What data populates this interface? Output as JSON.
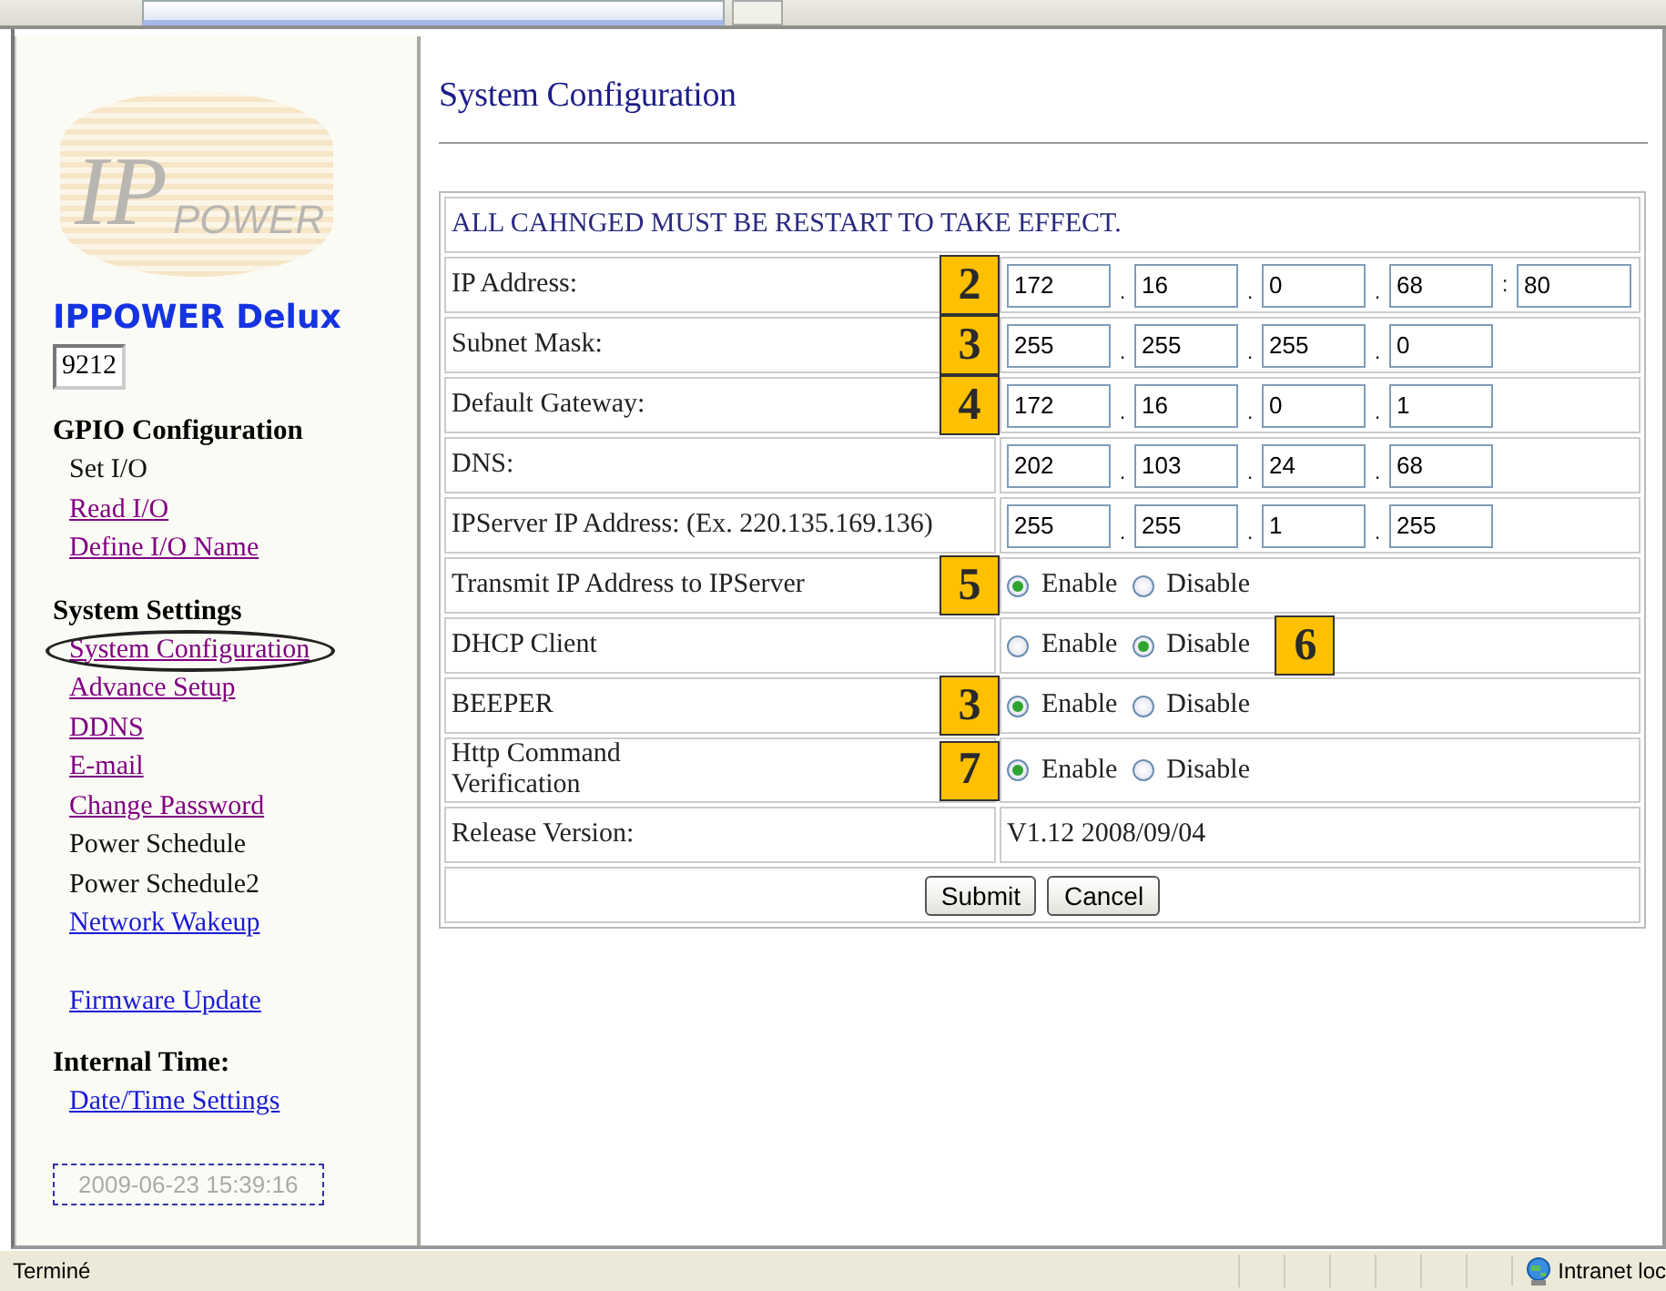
{
  "sidebar": {
    "logo": {
      "text": "IP",
      "subtext": "POWER"
    },
    "product": "IPPOWER Delux",
    "device_id": "9212",
    "sections": [
      {
        "title": "GPIO Configuration",
        "items": [
          {
            "label": "Set I/O",
            "kind": "text",
            "circled": false
          },
          {
            "label": "Read I/O",
            "kind": "visited",
            "circled": false
          },
          {
            "label": "Define I/O Name",
            "kind": "visited",
            "circled": false
          }
        ]
      },
      {
        "title": "System Settings",
        "items": [
          {
            "label": "System Configuration",
            "kind": "visited",
            "circled": true
          },
          {
            "label": "Advance Setup",
            "kind": "visited",
            "circled": false
          },
          {
            "label": "DDNS",
            "kind": "visited",
            "circled": false
          },
          {
            "label": "E-mail",
            "kind": "visited",
            "circled": false
          },
          {
            "label": "Change Password",
            "kind": "visited",
            "circled": false
          },
          {
            "label": "Power Schedule",
            "kind": "text",
            "circled": false
          },
          {
            "label": "Power Schedule2",
            "kind": "text",
            "circled": false
          },
          {
            "label": "Network Wakeup",
            "kind": "link",
            "circled": false
          }
        ]
      },
      {
        "items": [
          {
            "label": "Firmware Update",
            "kind": "link",
            "circled": false
          }
        ]
      },
      {
        "title": "Internal Time:",
        "items": [
          {
            "label": "Date/Time Settings",
            "kind": "link",
            "circled": false
          }
        ]
      }
    ],
    "clock": "2009-06-23 15:39:16"
  },
  "main": {
    "title": "System Configuration",
    "notice": "ALL CAHNGED MUST BE RESTART TO TAKE EFFECT.",
    "rows": [
      {
        "kind": "ip",
        "label": "IP Address:",
        "badge": "2",
        "octets": [
          "172",
          "16",
          "0",
          "68"
        ],
        "separators": [
          ".",
          ".",
          "."
        ],
        "port_separator": ":",
        "port": "80"
      },
      {
        "kind": "ip",
        "label": "Subnet Mask:",
        "badge": "3",
        "octets": [
          "255",
          "255",
          "255",
          "0"
        ],
        "separators": [
          ".",
          ".",
          "."
        ]
      },
      {
        "kind": "ip",
        "label": "Default Gateway:",
        "badge": "4",
        "octets": [
          "172",
          "16",
          "0",
          "1"
        ],
        "separators": [
          ".",
          ".",
          "."
        ]
      },
      {
        "kind": "ip",
        "label": "DNS:",
        "octets": [
          "202",
          "103",
          "24",
          "68"
        ],
        "separators": [
          ".",
          ".",
          "."
        ]
      },
      {
        "kind": "ip",
        "label": "IPServer IP Address: (Ex. 220.135.169.136)",
        "octets": [
          "255",
          "255",
          "1",
          "255"
        ],
        "separators": [
          ".",
          ".",
          "."
        ]
      },
      {
        "kind": "radio",
        "label": "Transmit IP Address to IPServer",
        "badge": "5",
        "options": [
          {
            "label": "Enable",
            "selected": true
          },
          {
            "label": "Disable",
            "selected": false
          }
        ]
      },
      {
        "kind": "radio",
        "label": "DHCP Client",
        "option_badge": "6",
        "options": [
          {
            "label": "Enable",
            "selected": false
          },
          {
            "label": "Disable",
            "selected": true
          }
        ]
      },
      {
        "kind": "radio",
        "label": "BEEPER",
        "badge": "3",
        "options": [
          {
            "label": "Enable",
            "selected": true
          },
          {
            "label": "Disable",
            "selected": false
          }
        ]
      },
      {
        "kind": "radio",
        "label": "Http Command\nVerification",
        "badge": "7",
        "options": [
          {
            "label": "Enable",
            "selected": true
          },
          {
            "label": "Disable",
            "selected": false
          }
        ]
      },
      {
        "kind": "text",
        "label": "Release Version:",
        "value": "V1.12 2008/09/04"
      }
    ],
    "buttons": [
      "Submit",
      "Cancel"
    ]
  },
  "status_bar": {
    "text": "Terminé",
    "zone": "Intranet loc"
  }
}
